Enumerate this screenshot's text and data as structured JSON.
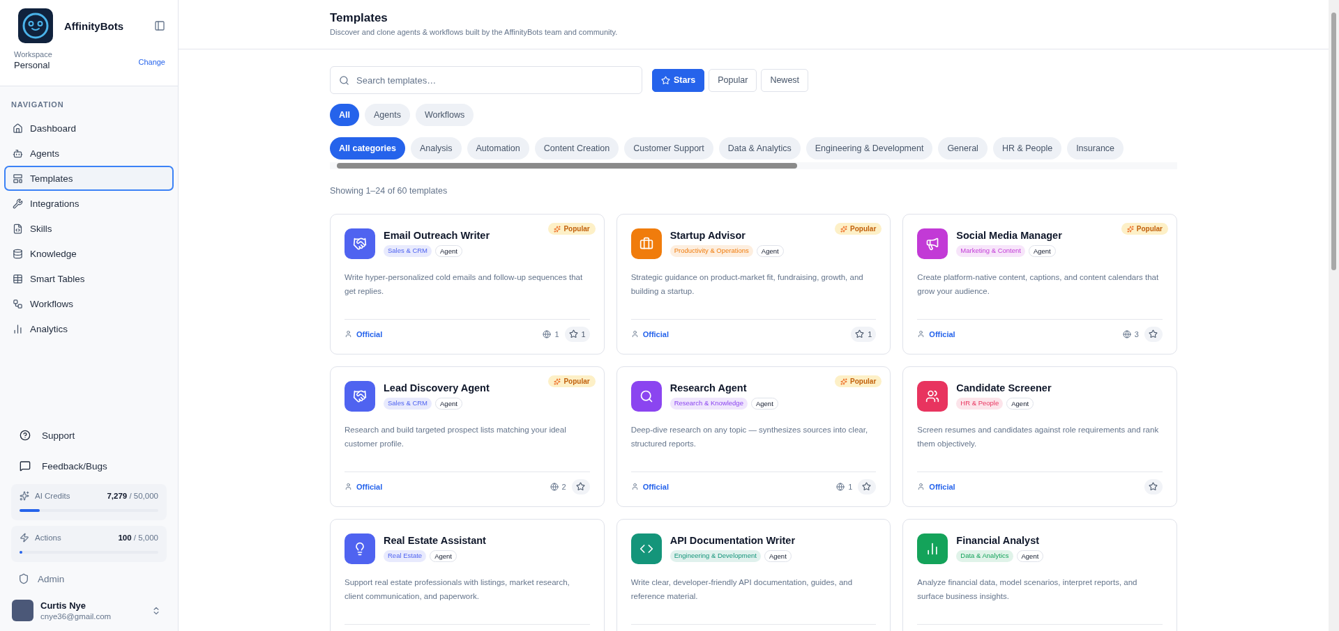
{
  "brand": {
    "name": "AffinityBots"
  },
  "workspace": {
    "label": "Workspace",
    "name": "Personal",
    "action": "Change"
  },
  "navigation": {
    "heading": "NAVIGATION",
    "items": [
      {
        "label": "Dashboard",
        "selected": false
      },
      {
        "label": "Agents",
        "selected": false
      },
      {
        "label": "Templates",
        "selected": true
      },
      {
        "label": "Integrations",
        "selected": false
      },
      {
        "label": "Skills",
        "selected": false
      },
      {
        "label": "Knowledge",
        "selected": false
      },
      {
        "label": "Smart Tables",
        "selected": false
      },
      {
        "label": "Workflows",
        "selected": false
      },
      {
        "label": "Analytics",
        "selected": false
      }
    ]
  },
  "footer_links": [
    {
      "label": "Support"
    },
    {
      "label": "Feedback/Bugs"
    }
  ],
  "usage": [
    {
      "label": "AI Credits",
      "used": "7,279",
      "limit": "/ 50,000",
      "level": 0.146
    },
    {
      "label": "Actions",
      "used": "100",
      "limit": "/ 5,000",
      "level": 0.02
    }
  ],
  "admin": {
    "label": "Admin"
  },
  "user": {
    "name": "Curtis Nye",
    "email": "cnye36@gmail.com"
  },
  "page": {
    "title": "Templates",
    "subtitle": "Discover and clone agents & workflows built by the AffinityBots team and community."
  },
  "search": {
    "placeholder": "Search templates…"
  },
  "sort_options": [
    {
      "label": "Stars",
      "selected": true
    },
    {
      "label": "Popular",
      "selected": false
    },
    {
      "label": "Newest",
      "selected": false
    }
  ],
  "type_tabs": [
    {
      "label": "All",
      "selected": true
    },
    {
      "label": "Agents",
      "selected": false
    },
    {
      "label": "Workflows",
      "selected": false
    }
  ],
  "categories": [
    {
      "label": "All categories",
      "selected": true
    },
    {
      "label": "Analysis",
      "selected": false
    },
    {
      "label": "Automation",
      "selected": false
    },
    {
      "label": "Content Creation",
      "selected": false
    },
    {
      "label": "Customer Support",
      "selected": false
    },
    {
      "label": "Data & Analytics",
      "selected": false
    },
    {
      "label": "Engineering & Development",
      "selected": false
    },
    {
      "label": "General",
      "selected": false
    },
    {
      "label": "HR & People",
      "selected": false
    },
    {
      "label": "Insurance",
      "selected": false
    }
  ],
  "result_count": "Showing 1–24 of 60 templates",
  "templates": [
    {
      "title": "Email Outreach Writer",
      "badge": "Popular",
      "color": "#4f63f0",
      "category": "Sales & CRM",
      "type": "Agent",
      "description": "Write hyper-personalized cold emails and follow-up sequences that get replies.",
      "author": "Official",
      "uses": "1",
      "star_count": "1"
    },
    {
      "title": "Startup Advisor",
      "badge": "Popular",
      "color": "#f07c0c",
      "category": "Productivity & Operations",
      "type": "Agent",
      "description": "Strategic guidance on product-market fit, fundraising, growth, and building a startup.",
      "author": "Official",
      "star_count": "1"
    },
    {
      "title": "Social Media Manager",
      "badge": "Popular",
      "color": "#c23ad6",
      "category": "Marketing & Content",
      "type": "Agent",
      "description": "Create platform-native content, captions, and content calendars that grow your audience.",
      "author": "Official",
      "uses": "3"
    },
    {
      "title": "Lead Discovery Agent",
      "badge": "Popular",
      "color": "#4f63f0",
      "category": "Sales & CRM",
      "type": "Agent",
      "description": "Research and build targeted prospect lists matching your ideal customer profile.",
      "author": "Official",
      "uses": "2"
    },
    {
      "title": "Research Agent",
      "badge": "Popular",
      "color": "#8b45f0",
      "category": "Research & Knowledge",
      "type": "Agent",
      "description": "Deep-dive research on any topic — synthesizes sources into clear, structured reports.",
      "author": "Official",
      "uses": "1"
    },
    {
      "title": "Candidate Screener",
      "color": "#e8345f",
      "category": "HR & People",
      "type": "Agent",
      "description": "Screen resumes and candidates against role requirements and rank them objectively.",
      "author": "Official"
    },
    {
      "title": "Real Estate Assistant",
      "color": "#4f63f0",
      "category": "Real Estate",
      "type": "Agent",
      "description": "Support real estate professionals with listings, market research, client communication, and paperwork."
    },
    {
      "title": "API Documentation Writer",
      "color": "#14957a",
      "category": "Engineering & Development",
      "type": "Agent",
      "description": "Write clear, developer-friendly API documentation, guides, and reference material."
    },
    {
      "title": "Financial Analyst",
      "color": "#14a35a",
      "category": "Data & Analytics",
      "type": "Agent",
      "description": "Analyze financial data, model scenarios, interpret reports, and surface business insights."
    }
  ]
}
